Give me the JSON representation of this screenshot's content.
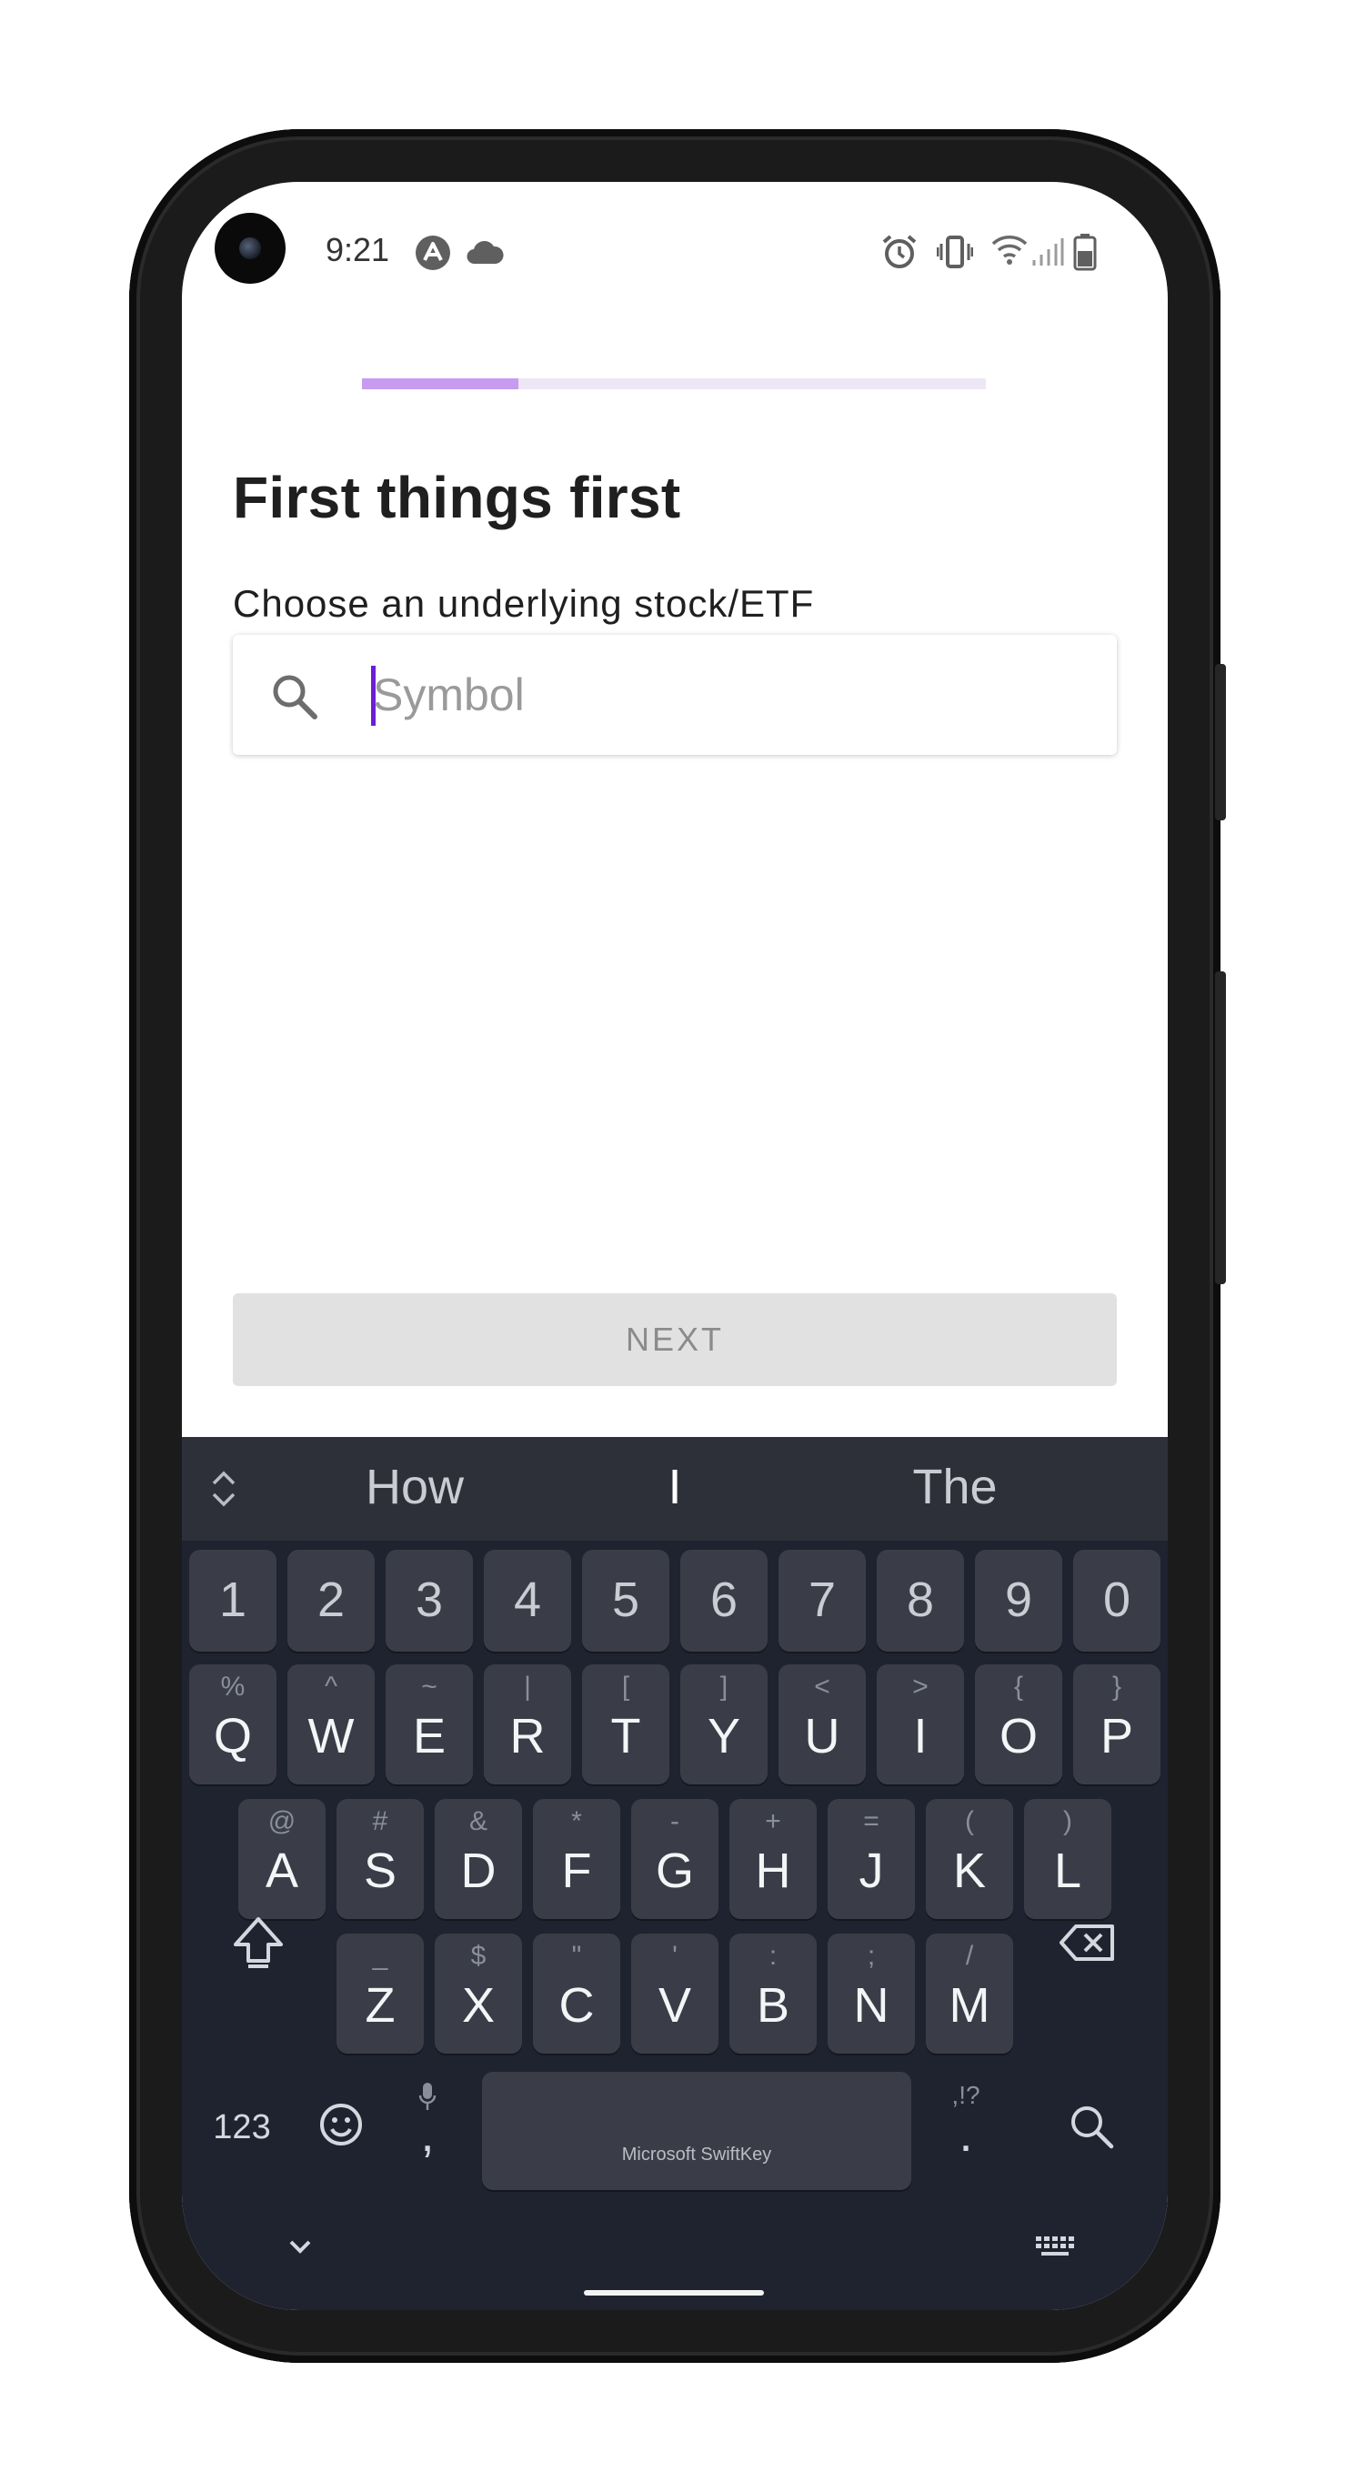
{
  "status_bar": {
    "time": "9:21",
    "left_icons": [
      "app-notification-icon",
      "cloud-icon"
    ],
    "right_icons": [
      "alarm-icon",
      "vibrate-icon",
      "wifi-icon",
      "cell-signal-icon",
      "battery-icon"
    ]
  },
  "progress": {
    "value": 0.25,
    "color": "#c79bf0"
  },
  "page": {
    "title": "First things first",
    "field_label": "Choose an underlying stock/ETF",
    "search": {
      "placeholder": "Symbol",
      "value": "",
      "icon": "search-icon"
    },
    "next_label": "NEXT"
  },
  "keyboard": {
    "brand": "Microsoft SwiftKey",
    "suggestions": [
      "How",
      "I",
      "The"
    ],
    "number_row": [
      "1",
      "2",
      "3",
      "4",
      "5",
      "6",
      "7",
      "8",
      "9",
      "0"
    ],
    "row1": [
      {
        "main": "Q",
        "alt": "%"
      },
      {
        "main": "W",
        "alt": "^"
      },
      {
        "main": "E",
        "alt": "~"
      },
      {
        "main": "R",
        "alt": "|"
      },
      {
        "main": "T",
        "alt": "["
      },
      {
        "main": "Y",
        "alt": "]"
      },
      {
        "main": "U",
        "alt": "<"
      },
      {
        "main": "I",
        "alt": ">"
      },
      {
        "main": "O",
        "alt": "{"
      },
      {
        "main": "P",
        "alt": "}"
      }
    ],
    "row2": [
      {
        "main": "A",
        "alt": "@"
      },
      {
        "main": "S",
        "alt": "#"
      },
      {
        "main": "D",
        "alt": "&"
      },
      {
        "main": "F",
        "alt": "*"
      },
      {
        "main": "G",
        "alt": "-"
      },
      {
        "main": "H",
        "alt": "+"
      },
      {
        "main": "J",
        "alt": "="
      },
      {
        "main": "K",
        "alt": "("
      },
      {
        "main": "L",
        "alt": ")"
      }
    ],
    "row3": [
      {
        "main": "Z",
        "alt": "_"
      },
      {
        "main": "X",
        "alt": "$"
      },
      {
        "main": "C",
        "alt": "\""
      },
      {
        "main": "V",
        "alt": "'"
      },
      {
        "main": "B",
        "alt": ":"
      },
      {
        "main": "N",
        "alt": ";"
      },
      {
        "main": "M",
        "alt": "/"
      }
    ],
    "bottom": {
      "numbers_label": "123",
      "comma": ",",
      "period": ".",
      "period_alt": ",!?"
    }
  },
  "colors": {
    "accent": "#6a1fd6",
    "keyboard_bg": "#1f2330",
    "key_bg": "#3a3d47"
  }
}
